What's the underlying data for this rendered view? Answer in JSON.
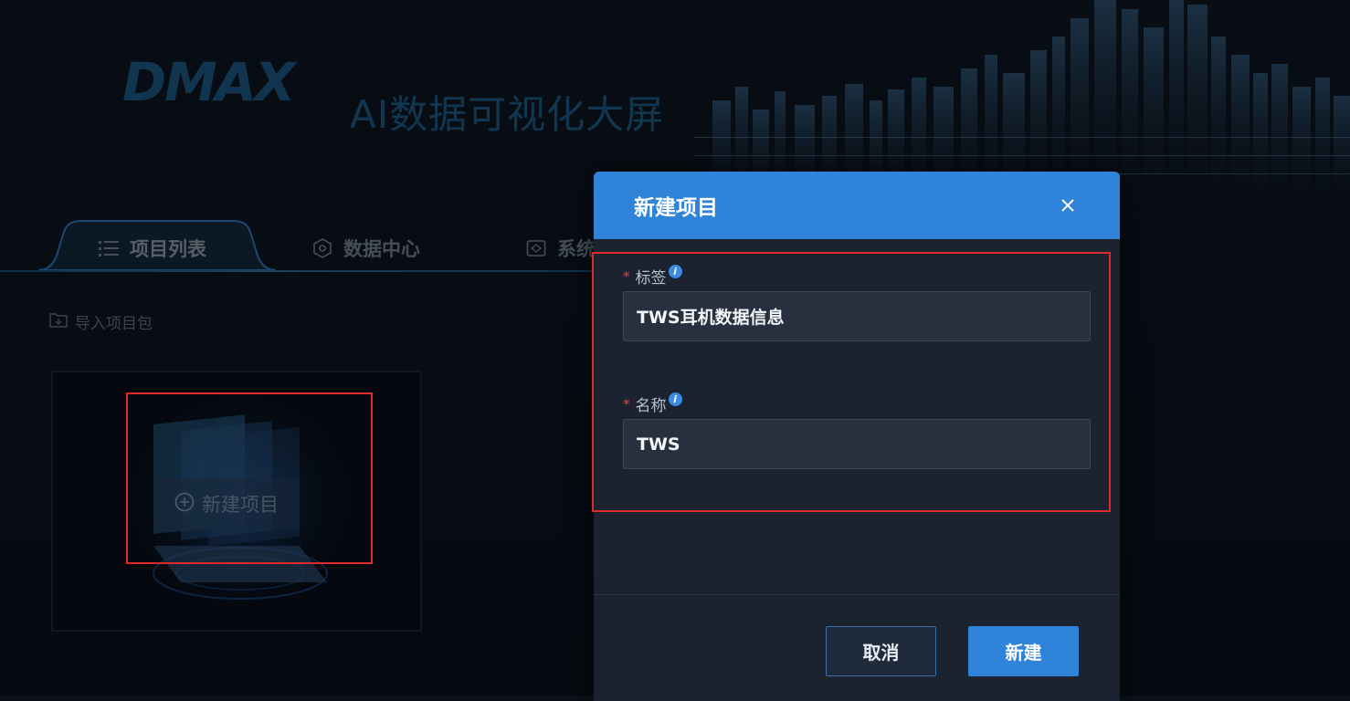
{
  "app": {
    "logo_text": "DMAX",
    "title": "AI数据可视化大屏"
  },
  "tabs": [
    {
      "label": "项目列表",
      "icon": "list-icon",
      "active": true
    },
    {
      "label": "数据中心",
      "icon": "hexagon-icon",
      "active": false
    },
    {
      "label": "系统",
      "icon": "system-box-icon",
      "active": false
    }
  ],
  "toolbar": {
    "import_label": "导入项目包"
  },
  "project_card": {
    "new_project_label": "新建项目"
  },
  "modal": {
    "title": "新建项目",
    "fields": [
      {
        "label": "标签",
        "required_mark": "*",
        "value": "TWS耳机数据信息"
      },
      {
        "label": "名称",
        "required_mark": "*",
        "value": "TWS"
      }
    ],
    "cancel_label": "取消",
    "create_label": "新建"
  },
  "colors": {
    "accent": "#2f84d9",
    "highlight_box": "#e02a2a",
    "background": "#0b1019"
  }
}
